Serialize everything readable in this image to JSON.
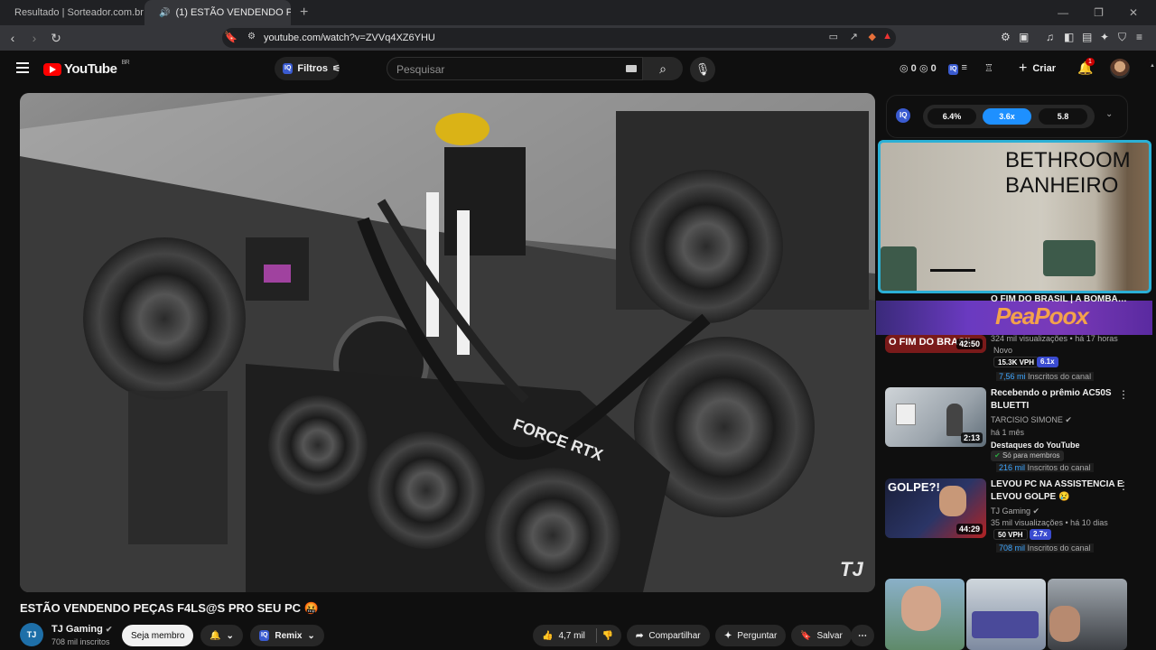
{
  "browser": {
    "tabs": [
      {
        "title": "Resultado | Sorteador.com.br - O Si…",
        "active": false
      },
      {
        "title": "(1) ESTÃO VENDENDO PEÇAS…",
        "active": true
      }
    ],
    "url": "youtube.com/watch?v=ZVVq4XZ6YHU"
  },
  "header": {
    "logo": "YouTube",
    "logo_region": "BR",
    "filters_label": "Filtros",
    "search_placeholder": "Pesquisar",
    "stat_views": "0",
    "stat_likes": "0",
    "create_label": "Criar",
    "notifications": "1"
  },
  "video": {
    "title": "ESTÃO VENDENDO PEÇAS F4LS@S PRO SEU PC 🤬",
    "overlay_text": "FORCE RTX",
    "watermark": "TJ",
    "channel": {
      "name": "TJ Gaming",
      "avatar_text": "TJ",
      "subscribers": "708 mil inscritos",
      "join_label": "Seja membro",
      "remix_label": "Remix"
    },
    "actions": {
      "likes": "4,7 mil",
      "share_label": "Compartilhar",
      "ask_label": "Perguntar",
      "save_label": "Salvar"
    }
  },
  "sidebar": {
    "iq_values": [
      "6.4%",
      "3.6x",
      "5.8"
    ],
    "webcam_text": [
      "BETHROOM",
      "BANHEIRO"
    ],
    "overlay_logo": "PeaPoox",
    "recommendations": [
      {
        "title": "O FIM DO BRASIL | A BOMBA…",
        "thumb_text": "O FIM DO BRASIL",
        "duration": "42:50",
        "meta": "324 mil visualizações • há 17 horas",
        "badge": "Novo",
        "vph": "15.3K VPH",
        "mult": "6.1x",
        "subs_num": "7,56 mi",
        "subs_label": "Inscritos do canal"
      },
      {
        "title_line1": "Recebendo o prêmio AC50S",
        "title_line2": "BLUETTI",
        "channel": "TARCISIO SIMONE",
        "duration": "2:13",
        "meta": "há 1 mês",
        "badge": "Destaques do YouTube",
        "members": "Só para membros",
        "subs_num": "216 mil",
        "subs_label": "Inscritos do canal"
      },
      {
        "title_line1": "LEVOU PC NA ASSISTENCIA E",
        "title_line2": "LEVOU GOLPE 😢",
        "thumb_text": "GOLPE?!",
        "channel": "TJ Gaming",
        "duration": "44:29",
        "meta": "35 mil visualizações • há 10 dias",
        "vph": "50 VPH",
        "mult": "2.7x",
        "subs_num": "708 mil",
        "subs_label": "Inscritos do canal"
      }
    ]
  },
  "colors": {
    "accent_red": "#ff0000",
    "iq_blue": "#1e90ff",
    "cam_border": "#2bb0d6"
  }
}
